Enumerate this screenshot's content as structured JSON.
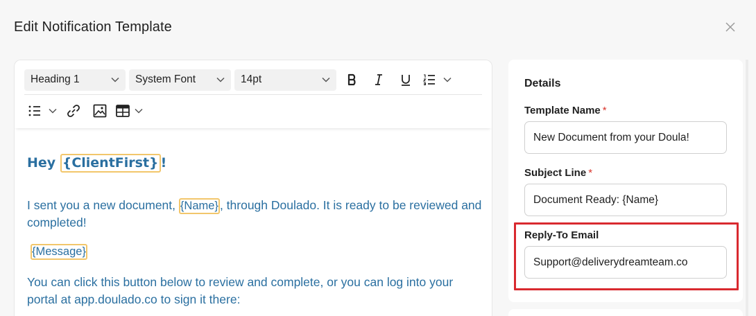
{
  "modal": {
    "title": "Edit Notification Template",
    "close_icon": "close-icon"
  },
  "toolbar": {
    "block_format": "Heading 1",
    "font_family": "System Font",
    "font_size": "14pt",
    "icons": {
      "bold": "bold-icon",
      "italic": "italic-icon",
      "underline": "underline-icon",
      "numbered_list": "numbered-list-icon",
      "bullet_list": "bullet-list-icon",
      "link": "link-icon",
      "image": "image-icon",
      "table": "table-icon"
    }
  },
  "editor": {
    "heading_prefix": "Hey ",
    "heading_tag": "{ClientFirst}",
    "heading_suffix": "!",
    "p1_prefix": "I sent you a new document, ",
    "p1_tag": "{Name}",
    "p1_suffix": ", through Doulado. It is ready to be reviewed and completed!",
    "p2_tag": "{Message}",
    "p3": "You can click this button below to review and complete, or you can log into your portal at app.doulado.co to sign it there:"
  },
  "details": {
    "title": "Details",
    "template_name_label": "Template Name",
    "template_name_value": "New Document from your Doula!",
    "subject_label": "Subject Line",
    "subject_value": "Document Ready: {Name}",
    "reply_to_label": "Reply-To Email",
    "reply_to_value": "Support@deliverydreamteam.co",
    "required_mark": "*"
  },
  "colors": {
    "accent_text": "#2a6fa0",
    "tag_border": "#f2c66b",
    "highlight": "#d9292f",
    "required": "#d9342b"
  }
}
